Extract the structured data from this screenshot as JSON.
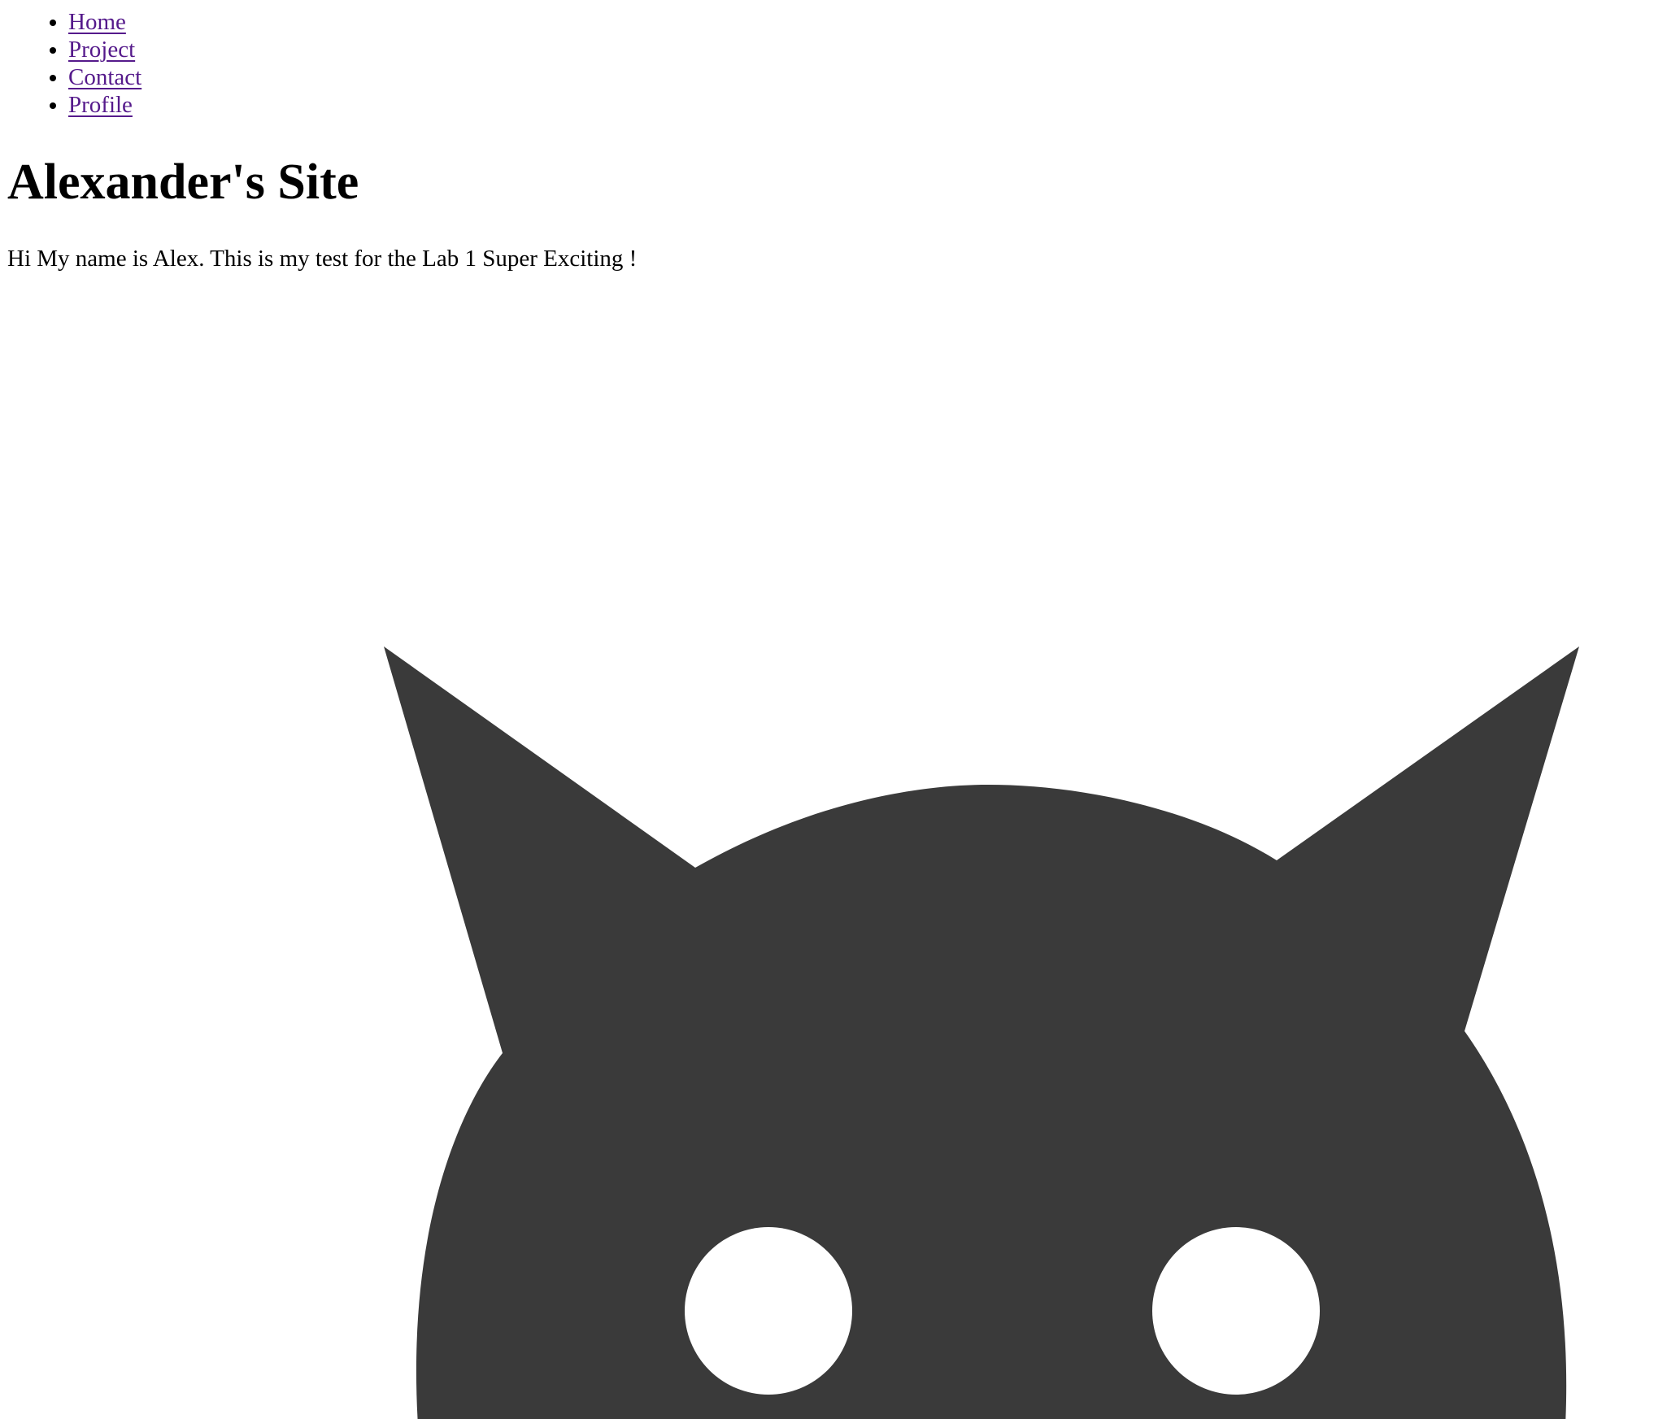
{
  "nav": {
    "items": [
      {
        "label": "Home"
      },
      {
        "label": "Project"
      },
      {
        "label": "Contact"
      },
      {
        "label": "Profile"
      }
    ]
  },
  "main": {
    "title": "Alexander's Site",
    "intro": "Hi My name is Alex. This is my test for the Lab 1 Super Exciting !"
  },
  "colors": {
    "link_visited": "#551a8b",
    "cat_fill": "#3a3a3a",
    "eyes": "#ffffff",
    "background": "#ffffff"
  },
  "image": {
    "icon": "cat-head-icon"
  }
}
